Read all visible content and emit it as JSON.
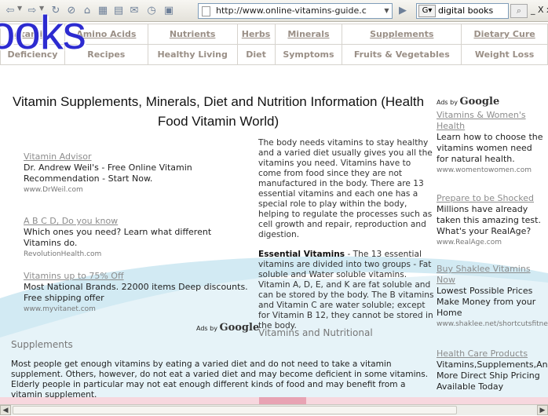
{
  "browser": {
    "url": "http://www.online-vitamins-guide.c",
    "search_engine_badge": "G",
    "search_value": "digital books",
    "window_controls": "_ Х x"
  },
  "nav": {
    "row1": [
      "Vitamins",
      "Amino Acids",
      "Nutrients",
      "Herbs",
      "Minerals",
      "Supplements",
      "Dietary Cure"
    ],
    "row2": [
      "Deficiency",
      "Recipes",
      "Healthy Living",
      "Diet",
      "Symptoms",
      "Fruits & Vegetables",
      "Weight Loss"
    ]
  },
  "overlay_brand": "ooks",
  "page_title": "Vitamin Supplements, Minerals, Diet and Nutrition Information (Health Food Vitamin World)",
  "ads_left": [
    {
      "title": "Vitamin Advisor",
      "desc": "Dr. Andrew Weil's - Free Online Vitamin Recommendation - Start Now.",
      "url": "www.DrWeil.com"
    },
    {
      "title": "A B C D, Do you know",
      "desc": "Which ones you need? Learn what different Vitamins do.",
      "url": "RevolutionHealth.com"
    },
    {
      "title": "Vitamins up to 75% Off",
      "desc": "Most National Brands. 22000 items Deep discounts. Free shipping offer",
      "url": "www.myvitanet.com"
    }
  ],
  "ads_by": {
    "prefix": "Ads by",
    "brand": "Google"
  },
  "middle": {
    "intro": "The body needs vitamins to stay healthy and a varied diet usually gives you all the vitamins you need. Vitamins have to come from food since they are not manufactured in the body. There are 13 essential vitamins and each one has a special role to play within the body, helping to regulate the processes such as cell growth and repair, reproduction and digestion.",
    "essential_bold": "Essential Vitamins",
    "essential_rest": " - The 13 essential vitamins are divided into two groups - Fat soluble and Water soluble vitamins. Vitamin A, D, E, and K are fat soluble and can be stored by the body. The B vitamins and Vitamin C are water soluble; except for Vitamin B 12, they cannot be stored in the body.",
    "subheading": "Vitamins and Nutritional"
  },
  "supplements": {
    "heading": "Supplements",
    "text": "Most people get enough vitamins by eating a varied diet and do not need to take a vitamin supplement. Others, however, do not eat a varied diet and may become deficient in some vitamins. Elderly people in particular may not eat enough different kinds of food and may benefit from a vitamin supplement."
  },
  "ads_right": [
    {
      "title": "Vitamins & Women's Health",
      "desc": "Learn how to choose the vitamins women need for natural health.",
      "url": "www.womentowomen.com"
    },
    {
      "title": "Prepare to be Shocked",
      "desc": "Millions have already taken this amazing test. What's your RealAge?",
      "url": "www.RealAge.com"
    },
    {
      "title": "Buy Shaklee Vitamins Now",
      "desc": "Lowest Possible Prices Make Money from your Home",
      "url": "www.shaklee.net/shortcutsfitness"
    },
    {
      "title": "Health Care Products",
      "desc": "Vitamins,Supplements,And More Direct Ship Pricing Available Today",
      "url": ""
    }
  ]
}
